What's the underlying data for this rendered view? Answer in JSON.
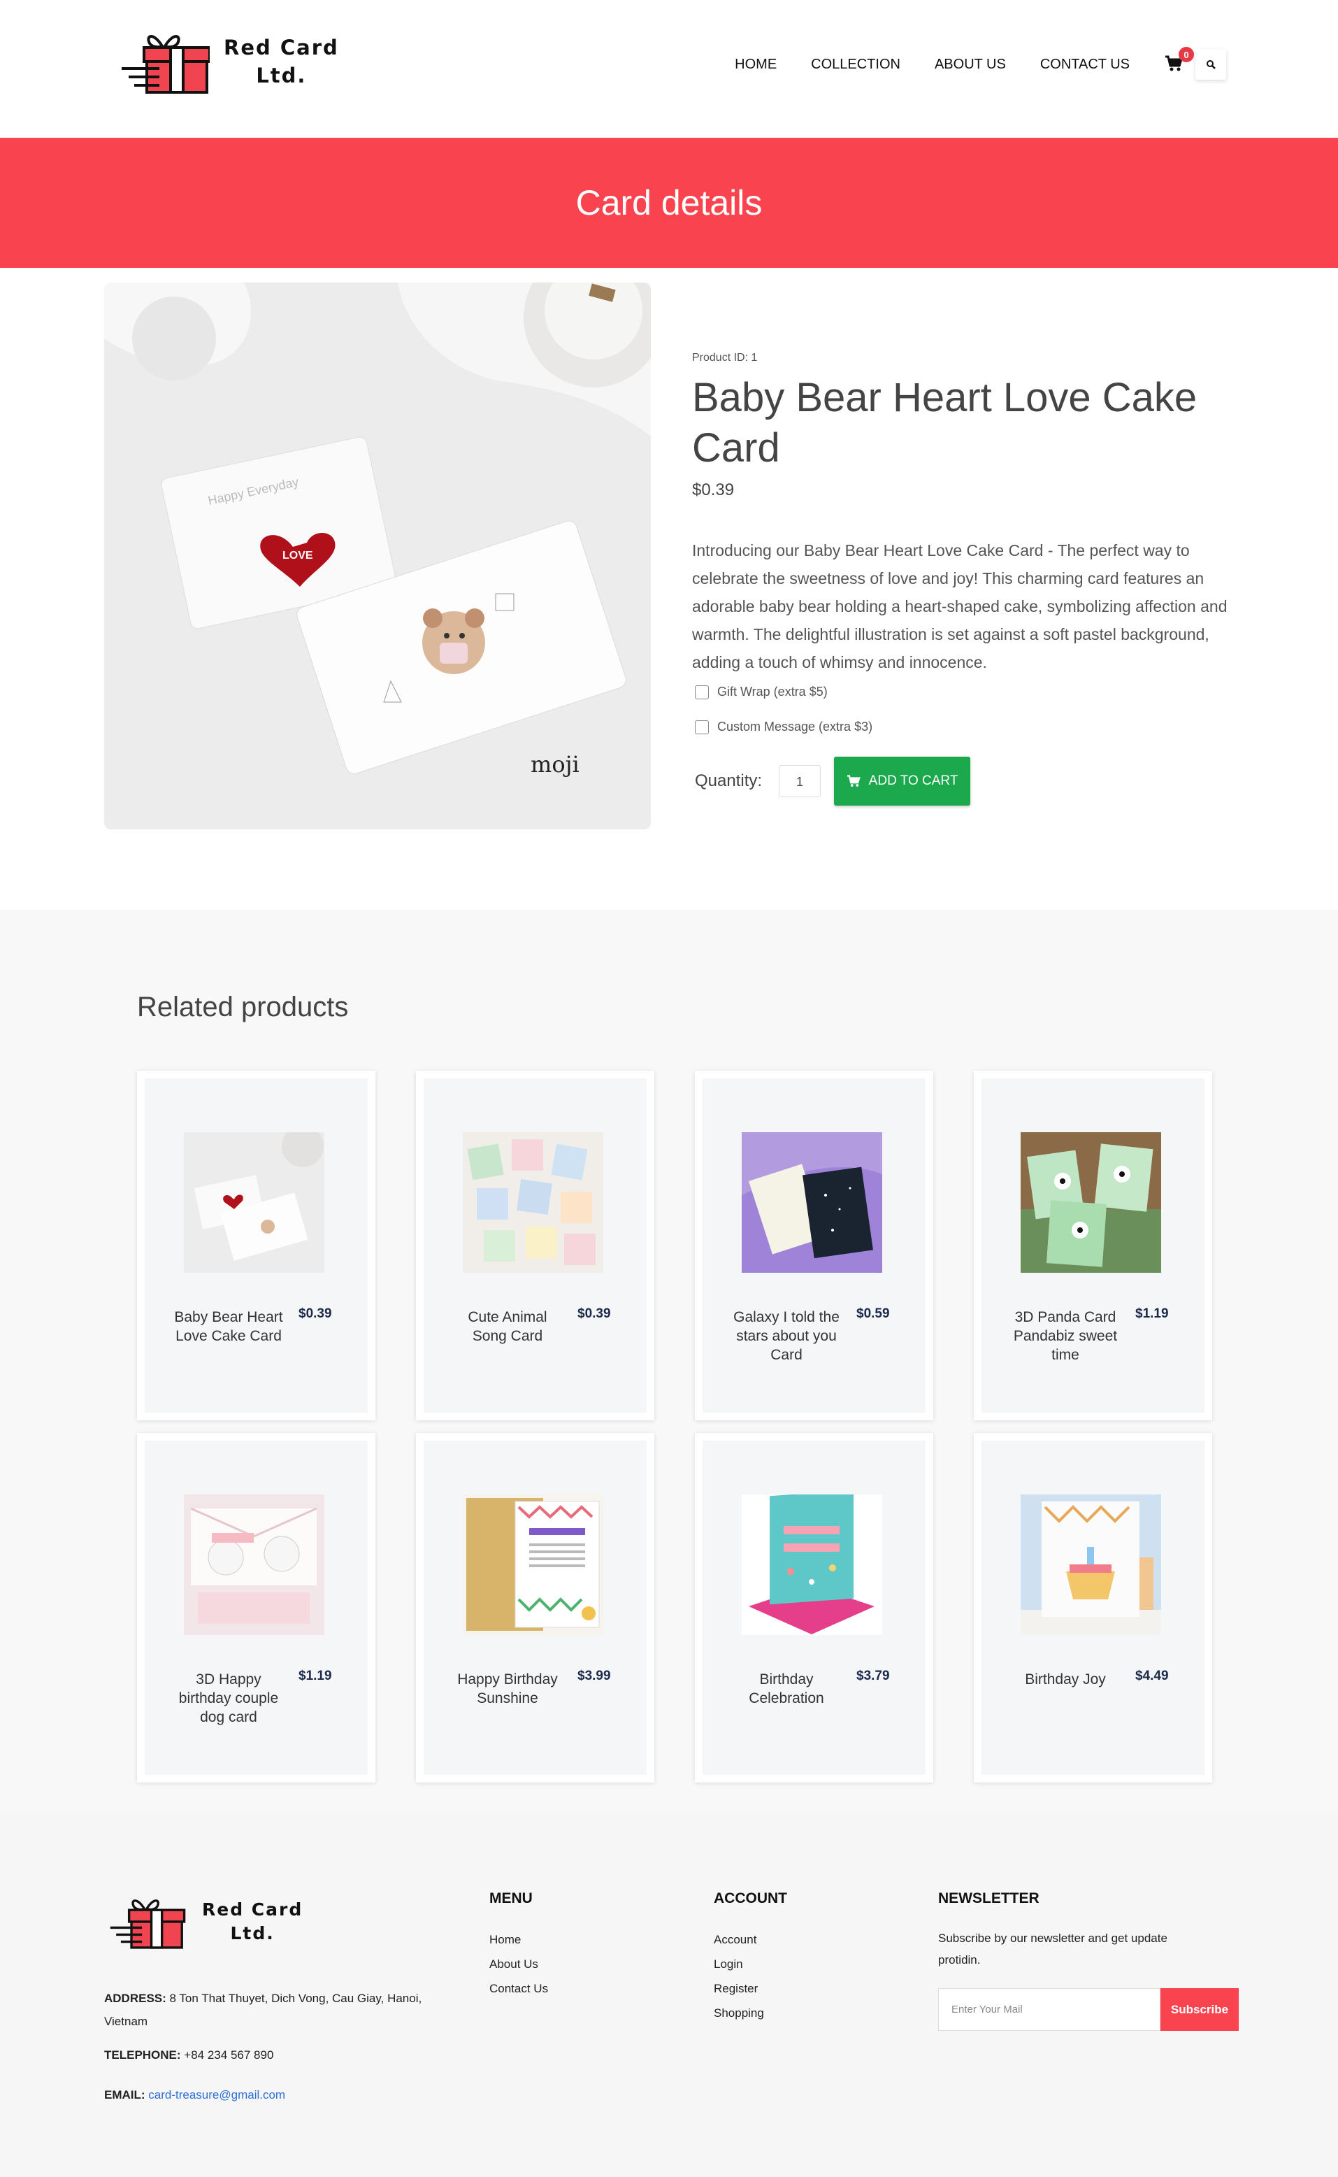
{
  "brand": {
    "name_line1": "Red Card",
    "name_line2": "Ltd."
  },
  "nav": {
    "items": [
      "HOME",
      "COLLECTION",
      "ABOUT US",
      "CONTACT US"
    ],
    "cart_count": "0"
  },
  "banner": {
    "title": "Card details"
  },
  "product": {
    "id_label": "Product ID: 1",
    "title": "Baby Bear Heart Love Cake Card",
    "price": "$0.39",
    "description": "Introducing our Baby Bear Heart Love Cake Card - The perfect way to celebrate the sweetness of love and joy! This charming card features an adorable baby bear holding a heart-shaped cake, symbolizing affection and warmth. The delightful illustration is set against a soft pastel background, adding a touch of whimsy and innocence.",
    "option_gift_wrap": "Gift Wrap (extra $5)",
    "option_custom_message": "Custom Message (extra $3)",
    "quantity_label": "Quantity:",
    "quantity_value": "1",
    "add_to_cart": "ADD TO CART",
    "image_text_love": "LOVE",
    "image_text_happy": "Happy Everyday",
    "image_text_brand": "moji"
  },
  "related": {
    "title": "Related products",
    "items": [
      {
        "name": "Baby Bear Heart Love Cake Card",
        "price": "$0.39"
      },
      {
        "name": "Cute Animal Song Card",
        "price": "$0.39"
      },
      {
        "name": "Galaxy I told the stars about you Card",
        "price": "$0.59"
      },
      {
        "name": "3D Panda Card Pandabiz sweet time",
        "price": "$1.19"
      },
      {
        "name": "3D Happy birthday couple dog card",
        "price": "$1.19"
      },
      {
        "name": "Happy Birthday Sunshine",
        "price": "$3.99"
      },
      {
        "name": "Birthday Celebration",
        "price": "$3.79"
      },
      {
        "name": "Birthday Joy",
        "price": "$4.49"
      }
    ]
  },
  "footer": {
    "address_label": "ADDRESS:",
    "address": "8 Ton That Thuyet, Dich Vong, Cau Giay, Hanoi, Vietnam",
    "telephone_label": "TELEPHONE:",
    "telephone": "+84 234 567 890",
    "email_label": "EMAIL:",
    "email": "card-treasure@gmail.com",
    "menu_title": "MENU",
    "menu_items": [
      "Home",
      "About Us",
      "Contact Us"
    ],
    "account_title": "ACCOUNT",
    "account_items": [
      "Account",
      "Login",
      "Register",
      "Shopping"
    ],
    "newsletter_title": "NEWSLETTER",
    "newsletter_text": "Subscribe by our newsletter and get update protidin.",
    "newsletter_placeholder": "Enter Your Mail",
    "subscribe": "Subscribe"
  },
  "colors": {
    "accent": "#f9434f",
    "green": "#1ca94e",
    "price_navy": "#1d2b4a"
  }
}
